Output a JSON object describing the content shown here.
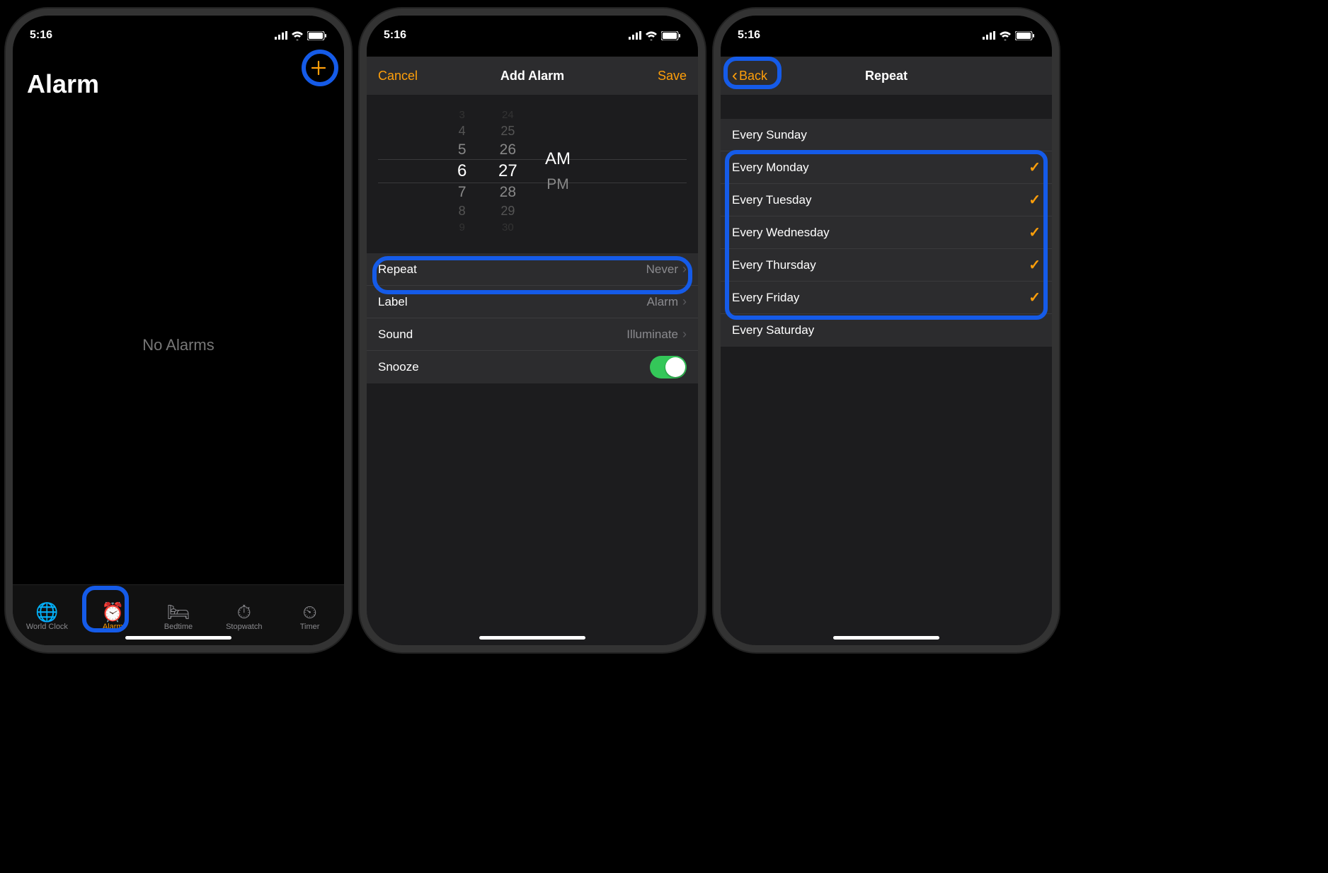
{
  "colors": {
    "accent": "#ff9f0a",
    "highlight": "#155be8",
    "toggle_on": "#34c759"
  },
  "status_time": "5:16",
  "screen1": {
    "title": "Alarm",
    "empty_text": "No Alarms",
    "tabs": [
      {
        "label": "World Clock",
        "icon": "globe"
      },
      {
        "label": "Alarm",
        "icon": "alarm",
        "active": true
      },
      {
        "label": "Bedtime",
        "icon": "bed"
      },
      {
        "label": "Stopwatch",
        "icon": "stopwatch"
      },
      {
        "label": "Timer",
        "icon": "timer"
      }
    ]
  },
  "screen2": {
    "nav": {
      "left": "Cancel",
      "title": "Add Alarm",
      "right": "Save"
    },
    "picker": {
      "hour": {
        "selected": "6",
        "above": [
          "3",
          "4",
          "5"
        ],
        "below": [
          "7",
          "8",
          "9"
        ]
      },
      "minute": {
        "selected": "27",
        "above": [
          "24",
          "25",
          "26"
        ],
        "below": [
          "28",
          "29",
          "30"
        ]
      },
      "period": {
        "selected": "AM",
        "other": "PM"
      }
    },
    "rows": {
      "repeat": {
        "label": "Repeat",
        "value": "Never"
      },
      "label": {
        "label": "Label",
        "value": "Alarm"
      },
      "sound": {
        "label": "Sound",
        "value": "Illuminate"
      },
      "snooze": {
        "label": "Snooze",
        "on": true
      }
    }
  },
  "screen3": {
    "nav": {
      "back": "Back",
      "title": "Repeat"
    },
    "days": [
      {
        "label": "Every Sunday",
        "checked": false
      },
      {
        "label": "Every Monday",
        "checked": true
      },
      {
        "label": "Every Tuesday",
        "checked": true
      },
      {
        "label": "Every Wednesday",
        "checked": true
      },
      {
        "label": "Every Thursday",
        "checked": true
      },
      {
        "label": "Every Friday",
        "checked": true
      },
      {
        "label": "Every Saturday",
        "checked": false
      }
    ]
  }
}
